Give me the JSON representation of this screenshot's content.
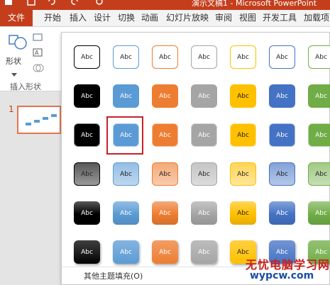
{
  "title": "演示文稿1 - Microsoft PowerPoint",
  "tabs": [
    "文件",
    "开始",
    "插入",
    "设计",
    "切换",
    "动画",
    "幻灯片放映",
    "审阅",
    "视图",
    "开发工具",
    "加载项"
  ],
  "ribbon": {
    "shape_label": "形状",
    "group_label": "插入形状"
  },
  "slide_number": "1",
  "gallery": {
    "cell_text": "Abc",
    "colors": [
      "#000000",
      "#5b9bd5",
      "#ed7d31",
      "#a5a5a5",
      "#ffc000",
      "#4472c4",
      "#70ad47"
    ],
    "rows": [
      {
        "style": "outline"
      },
      {
        "style": "solid"
      },
      {
        "style": "solid-light-border"
      },
      {
        "style": "gradient-light"
      },
      {
        "style": "gradient"
      },
      {
        "style": "gradient-shadow"
      }
    ],
    "selected": {
      "row": 2,
      "col": 1
    },
    "footer_text": "其他主题填充(O)"
  },
  "watermark": {
    "line1": "无忧电脑学习网",
    "line2": "wypcw.com"
  }
}
